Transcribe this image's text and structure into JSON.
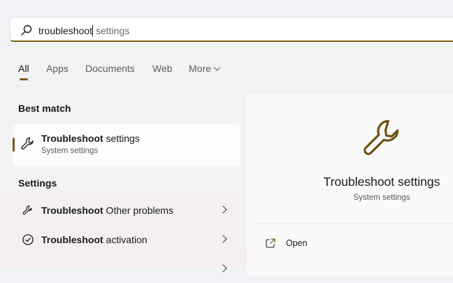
{
  "search": {
    "typed": "troubleshoot",
    "suggestion": " settings"
  },
  "tabs": [
    {
      "label": "All"
    },
    {
      "label": "Apps"
    },
    {
      "label": "Documents"
    },
    {
      "label": "Web"
    },
    {
      "label": "More"
    }
  ],
  "best_match": {
    "heading": "Best match",
    "title_bold": "Troubleshoot",
    "title_rest": " settings",
    "subtitle": "System settings",
    "icon": "wrench-icon"
  },
  "settings": {
    "heading": "Settings",
    "items": [
      {
        "bold": "Troubleshoot",
        "rest": " Other problems",
        "icon": "wrench-icon"
      },
      {
        "bold": "Troubleshoot",
        "rest": " activation",
        "icon": "check-circle-icon"
      }
    ]
  },
  "detail": {
    "title": "Troubleshoot settings",
    "subtitle": "System settings",
    "open_label": "Open",
    "icon": "wrench-icon"
  },
  "colors": {
    "accent": "#7a5b14"
  }
}
